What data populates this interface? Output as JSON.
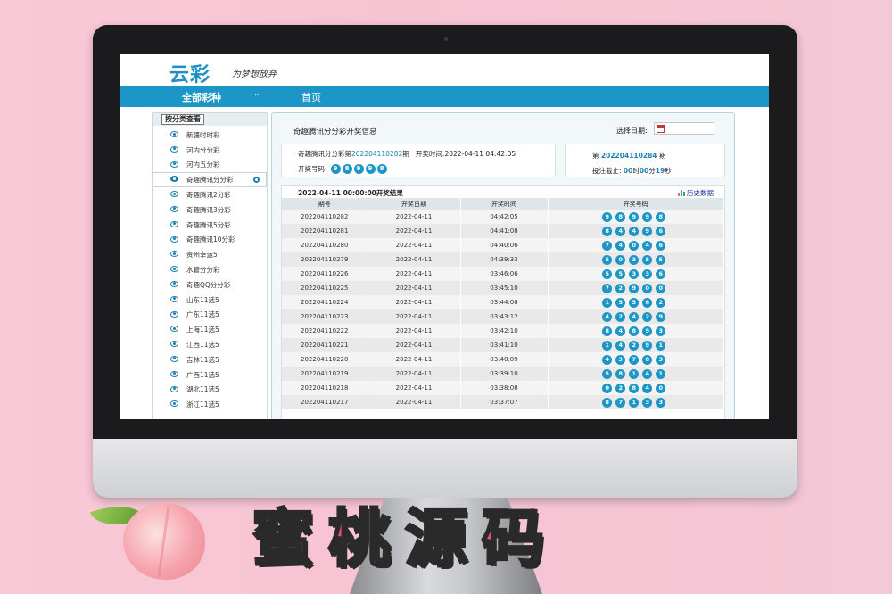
{
  "site": {
    "logo": "云彩",
    "slogan": "为梦想放弃"
  },
  "nav": {
    "all_games": "全部彩种",
    "chevron": "⌄",
    "home": "首页"
  },
  "sidebar": {
    "title": "按分类查看",
    "items": [
      {
        "label": "新疆时时彩",
        "active": false
      },
      {
        "label": "河内分分彩",
        "active": false
      },
      {
        "label": "河内五分彩",
        "active": false
      },
      {
        "label": "奇趣腾讯分分彩",
        "active": true
      },
      {
        "label": "奇趣腾讯2分彩",
        "active": false
      },
      {
        "label": "奇趣腾讯3分彩",
        "active": false
      },
      {
        "label": "奇趣腾讯5分彩",
        "active": false
      },
      {
        "label": "奇趣腾讯10分彩",
        "active": false
      },
      {
        "label": "贵州幸运5",
        "active": false
      },
      {
        "label": "水管分分彩",
        "active": false
      },
      {
        "label": "奇趣QQ分分彩",
        "active": false
      },
      {
        "label": "山东11选5",
        "active": false
      },
      {
        "label": "广东11选5",
        "active": false
      },
      {
        "label": "上海11选5",
        "active": false
      },
      {
        "label": "江西11选5",
        "active": false
      },
      {
        "label": "吉林11选5",
        "active": false
      },
      {
        "label": "广西11选5",
        "active": false
      },
      {
        "label": "湖北11选5",
        "active": false
      },
      {
        "label": "浙江11选5",
        "active": false
      }
    ]
  },
  "main": {
    "title": "奇趣腾讯分分彩开奖信息",
    "date_label": "选择日期:",
    "current": {
      "prefix": "奇趣腾讯分分彩第",
      "issue": "202204110282",
      "suffix": "期",
      "time_label": "开奖时间:",
      "time": "2022-04-11 04:42:05",
      "numbers_label": "开奖号码:",
      "numbers": [
        "9",
        "8",
        "9",
        "9",
        "8"
      ]
    },
    "next": {
      "prefix": "第",
      "issue": "202204110284",
      "suffix": "期",
      "countdown_label": "投注截止:",
      "hours": "00",
      "hours_unit": "时",
      "minutes": "00",
      "minutes_unit": "分",
      "seconds": "19",
      "seconds_unit": "秒"
    },
    "results_title": "2022-04-11 00:00:00开奖结果",
    "history_link": "历史数据",
    "columns": [
      "期号",
      "开奖日期",
      "开奖时间",
      "开奖号码"
    ],
    "rows": [
      {
        "issue": "202204110282",
        "date": "2022-04-11",
        "time": "04:42:05",
        "numbers": [
          "9",
          "8",
          "9",
          "9",
          "8"
        ]
      },
      {
        "issue": "202204110281",
        "date": "2022-04-11",
        "time": "04:41:08",
        "numbers": [
          "8",
          "4",
          "4",
          "9",
          "6"
        ]
      },
      {
        "issue": "202204110280",
        "date": "2022-04-11",
        "time": "04:40:06",
        "numbers": [
          "7",
          "4",
          "0",
          "4",
          "6"
        ]
      },
      {
        "issue": "202204110279",
        "date": "2022-04-11",
        "time": "04:39:33",
        "numbers": [
          "5",
          "0",
          "3",
          "5",
          "5"
        ]
      },
      {
        "issue": "202204110226",
        "date": "2022-04-11",
        "time": "03:46:06",
        "numbers": [
          "5",
          "5",
          "3",
          "3",
          "6"
        ]
      },
      {
        "issue": "202204110225",
        "date": "2022-04-11",
        "time": "03:45:10",
        "numbers": [
          "7",
          "2",
          "9",
          "0",
          "0"
        ]
      },
      {
        "issue": "202204110224",
        "date": "2022-04-11",
        "time": "03:44:08",
        "numbers": [
          "1",
          "5",
          "5",
          "6",
          "2"
        ]
      },
      {
        "issue": "202204110223",
        "date": "2022-04-11",
        "time": "03:43:12",
        "numbers": [
          "4",
          "2",
          "4",
          "2",
          "9"
        ]
      },
      {
        "issue": "202204110222",
        "date": "2022-04-11",
        "time": "03:42:10",
        "numbers": [
          "8",
          "4",
          "8",
          "9",
          "3"
        ]
      },
      {
        "issue": "202204110221",
        "date": "2022-04-11",
        "time": "03:41:10",
        "numbers": [
          "1",
          "4",
          "2",
          "9",
          "1"
        ]
      },
      {
        "issue": "202204110220",
        "date": "2022-04-11",
        "time": "03:40:09",
        "numbers": [
          "4",
          "3",
          "7",
          "8",
          "3"
        ]
      },
      {
        "issue": "202204110219",
        "date": "2022-04-11",
        "time": "03:39:10",
        "numbers": [
          "5",
          "8",
          "1",
          "4",
          "1"
        ]
      },
      {
        "issue": "202204110218",
        "date": "2022-04-11",
        "time": "03:38:08",
        "numbers": [
          "0",
          "2",
          "8",
          "4",
          "0"
        ]
      },
      {
        "issue": "202204110217",
        "date": "2022-04-11",
        "time": "03:37:07",
        "numbers": [
          "8",
          "7",
          "1",
          "3",
          "3"
        ]
      }
    ]
  },
  "branding": {
    "text": "蜜桃源码"
  },
  "colors": {
    "accent": "#1c96c6",
    "brand_pink": "#e74c8a",
    "background": "#f7c3d3"
  }
}
